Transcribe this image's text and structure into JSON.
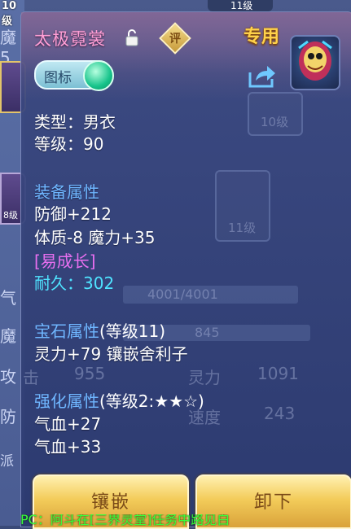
{
  "background": {
    "top_level_label": "10级",
    "top_right_level": "11级",
    "left_labels": [
      "魔5",
      "气",
      "魔",
      "攻",
      "防",
      "派"
    ],
    "slot_level": "8级",
    "ghost": {
      "slot_a_level": "10级",
      "slot_b_level": "11级",
      "hp_bar": "4001/4001",
      "mp_bar": "845",
      "attack_label": "击",
      "attack_value": "955",
      "spirit_label": "灵力",
      "spirit_value": "1091",
      "speed_label": "速度",
      "speed_value": "243"
    }
  },
  "item": {
    "name": "太极霓裳",
    "tag_exclusive": "专用",
    "rate_label": "评",
    "icon_toggle_label": "图标",
    "type_line": "类型：男衣",
    "level_line": "等级：90",
    "equip_section": "装备属性",
    "equip_stats": [
      "防御+212",
      "体质-8 魔力+35"
    ],
    "growth_tag": "[易成长]",
    "durability": "耐久：302",
    "gem_section_title": "宝石属性",
    "gem_section_suffix": "(等级11)",
    "gem_stats": "灵力+79 镶嵌舍利子",
    "enhance_section_title": "强化属性",
    "enhance_section_suffix": "(等级2:★★☆)",
    "enhance_stats": [
      "气血+27",
      "气血+33"
    ]
  },
  "buttons": {
    "inlay": "镶嵌",
    "unequip": "卸下"
  },
  "banner": "PC：阿斗在[三界灵堂]任务中路见白"
}
